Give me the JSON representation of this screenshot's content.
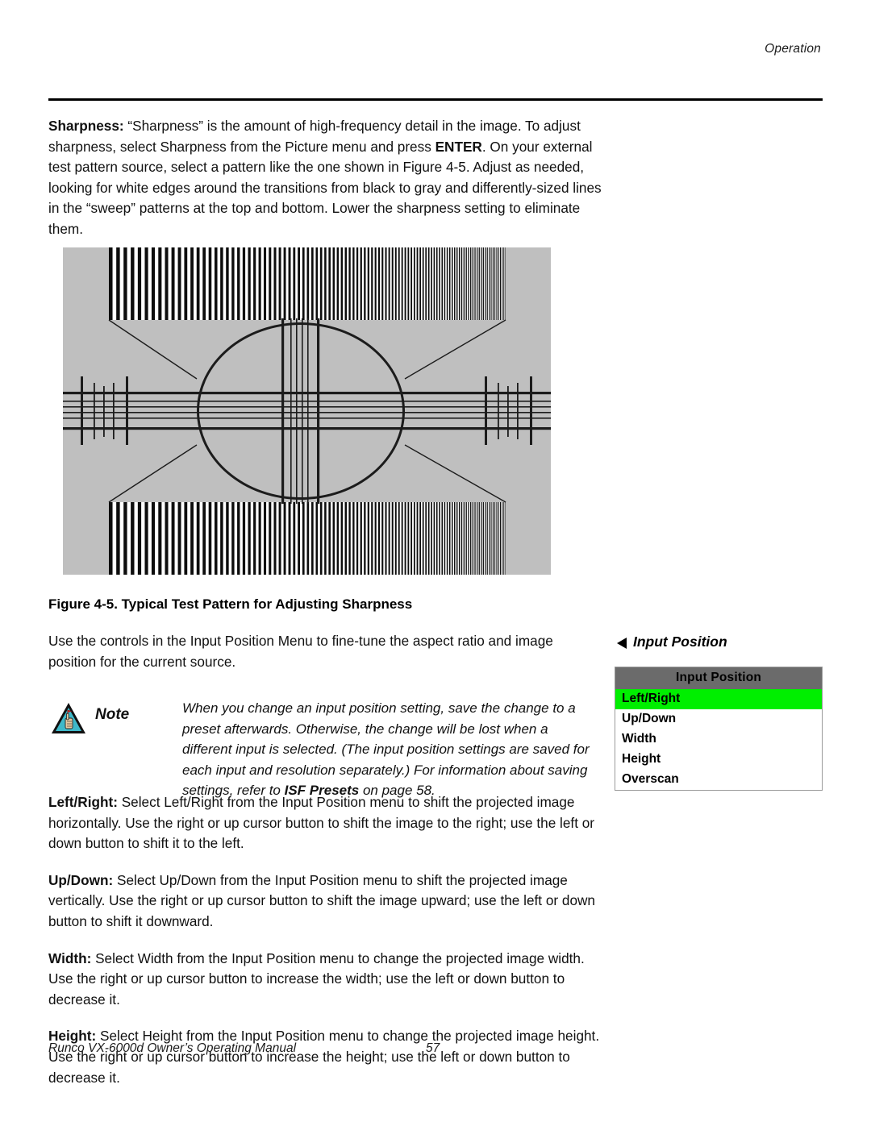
{
  "header": {
    "running_head": "Operation"
  },
  "intro": {
    "sharpness_label": "Sharpness:",
    "sharpness_body": " “Sharpness” is the amount of high-frequency detail in the image. To adjust sharpness, select Sharpness from the Picture menu and press ",
    "enter_key": "ENTER",
    "sharpness_body2": ". On your external test pattern source, select a pattern like the one shown in Figure 4-5. Adjust as needed, looking for white edges around the transitions from black to gray and differently-sized lines in the “sweep” patterns at the top and bottom. Lower the sharpness setting to eliminate them."
  },
  "figure": {
    "caption": "Figure 4-5. Typical Test Pattern for Adjusting Sharpness",
    "alt": "test-pattern-sharpness",
    "background_color": "#bfbfbf",
    "line_color": "#1c1c1c"
  },
  "intro_position": {
    "text": "Use the controls in the Input Position Menu to fine-tune the aspect ratio and image position for the current source."
  },
  "note": {
    "label": "Note",
    "icon": "note-triangle-hand-icon",
    "text_1": "When you change an input position setting, save the change to a preset afterwards. Otherwise, the change will be lost when a different input is selected. (The input position settings are saved for each input and resolution separately.) For information about saving settings, refer to ",
    "bold_ref": "ISF Presets",
    "text_2": " on page 58."
  },
  "sidebar": {
    "heading": "Input Position",
    "heading_icon": "triangle-left-icon",
    "menu": {
      "title": "Input Position",
      "selected_color": "#00ef00",
      "title_bg_color": "#6b6b6b",
      "items": [
        {
          "label": "Left/Right",
          "selected": true
        },
        {
          "label": "Up/Down",
          "selected": false
        },
        {
          "label": "Width",
          "selected": false
        },
        {
          "label": "Height",
          "selected": false
        },
        {
          "label": "Overscan",
          "selected": false
        }
      ]
    }
  },
  "descriptions": [
    {
      "term": "Left/Right:",
      "body": " Select Left/Right from the Input Position menu to shift the projected image horizontally. Use the right or up cursor button to shift the image to the right; use the left or down button to shift it to the left."
    },
    {
      "term": "Up/Down:",
      "body": " Select Up/Down from the Input Position menu to shift the projected image vertically. Use the right or up cursor button to shift the image upward; use the left or down button to shift it downward."
    },
    {
      "term": "Width:",
      "body": " Select Width from the Input Position menu to change the projected image width. Use the right or up cursor button to increase the width; use the left or down button to decrease it."
    },
    {
      "term": "Height:",
      "body": " Select Height from the Input Position menu to change the projected image height. Use the right or up cursor button to increase the height; use the left or down button to decrease it."
    }
  ],
  "footer": {
    "manual_title": "Runco VX-6000d Owner’s Operating Manual",
    "page_number": "57"
  }
}
